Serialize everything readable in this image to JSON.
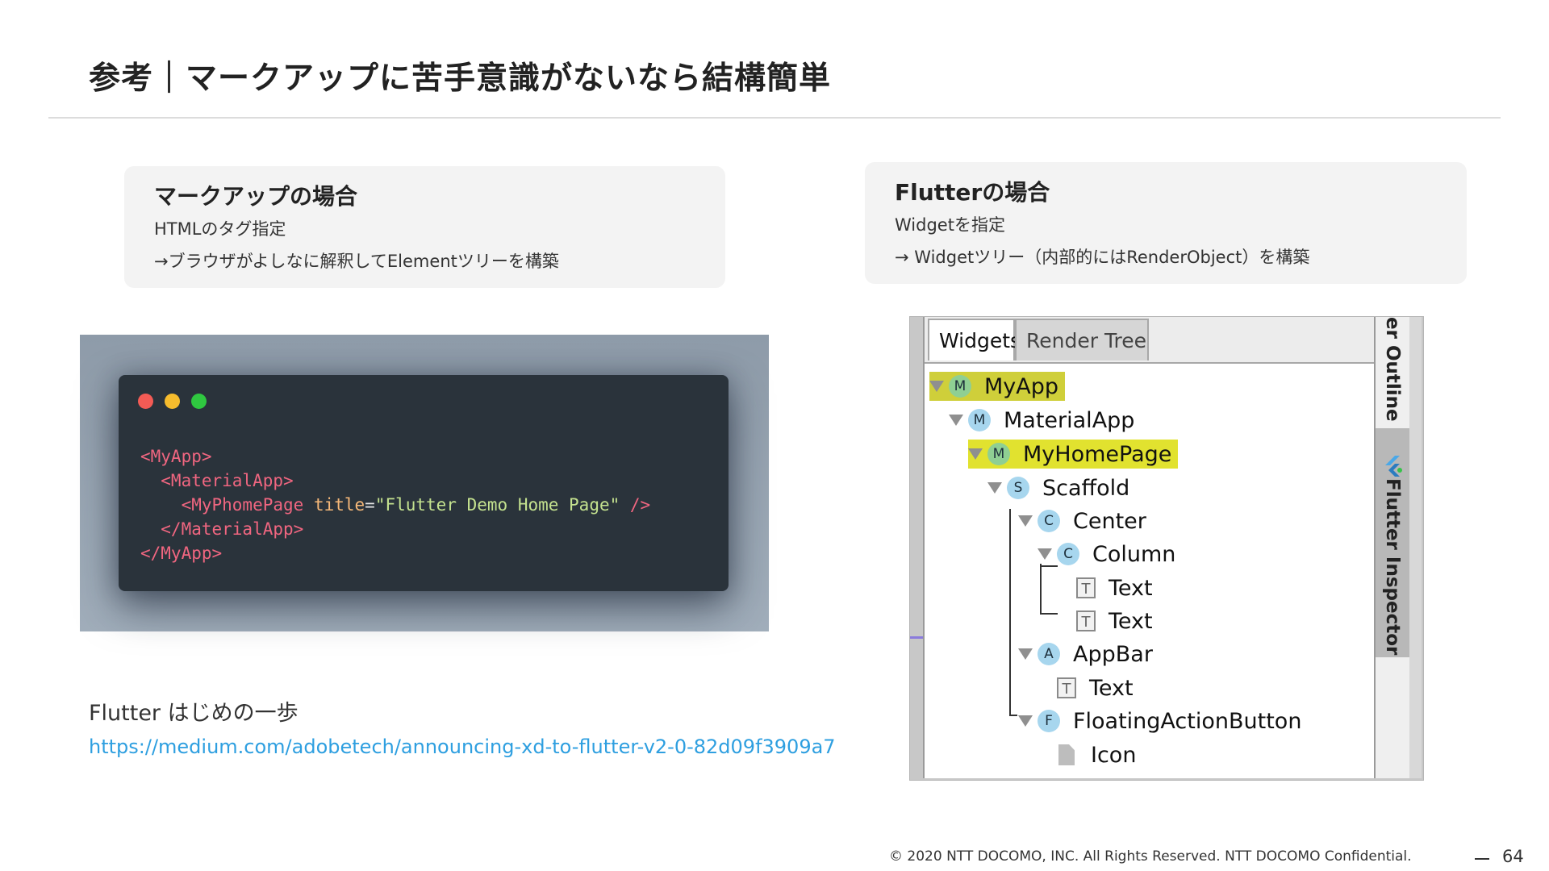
{
  "title": "参考｜マークアップに苦手意識がないなら結構簡単",
  "markup_card": {
    "heading": "マークアップの場合",
    "line1": "HTMLのタグ指定",
    "line2": "→ブラウザがよしなに解釈してElementツリーを構築"
  },
  "flutter_card": {
    "heading": "Flutterの場合",
    "line1": "Widgetを指定",
    "line2": "→ Widgetツリー（内部的にはRenderObject）を構築"
  },
  "code": {
    "line1": "<MyApp>",
    "line2": "  <MaterialApp>",
    "line3_tag": "    <MyPhomePage",
    "line3_attr": " title",
    "line3_eq": "=",
    "line3_str": "\"Flutter Demo Home Page\"",
    "line3_close": " />",
    "line4": "  </MaterialApp>",
    "line5": "</MyApp>"
  },
  "reference": {
    "title": "Flutter はじめの一歩",
    "url": "https://medium.com/adobetech/announcing-xd-to-flutter-v2-0-82d09f3909a7"
  },
  "inspector": {
    "tabs": [
      "Widgets",
      "Render Tree"
    ],
    "side_tabs": [
      "er Outline",
      "Flutter Inspector"
    ],
    "tree": [
      {
        "label": "MyApp",
        "badge": "M",
        "highlight": true
      },
      {
        "label": "MaterialApp",
        "badge": "M"
      },
      {
        "label": "MyHomePage",
        "badge": "M",
        "highlight": true
      },
      {
        "label": "Scaffold",
        "badge": "S"
      },
      {
        "label": "Center",
        "badge": "C"
      },
      {
        "label": "Column",
        "badge": "C"
      },
      {
        "label": "Text",
        "badge": "T"
      },
      {
        "label": "Text",
        "badge": "T"
      },
      {
        "label": "AppBar",
        "badge": "A"
      },
      {
        "label": "Text",
        "badge": "T"
      },
      {
        "label": "FloatingActionButton",
        "badge": "F"
      },
      {
        "label": "Icon",
        "badge": ""
      }
    ]
  },
  "footer": {
    "copyright": "© 2020 NTT DOCOMO, INC. All Rights Reserved. NTT DOCOMO Confidential.",
    "page": "64"
  }
}
